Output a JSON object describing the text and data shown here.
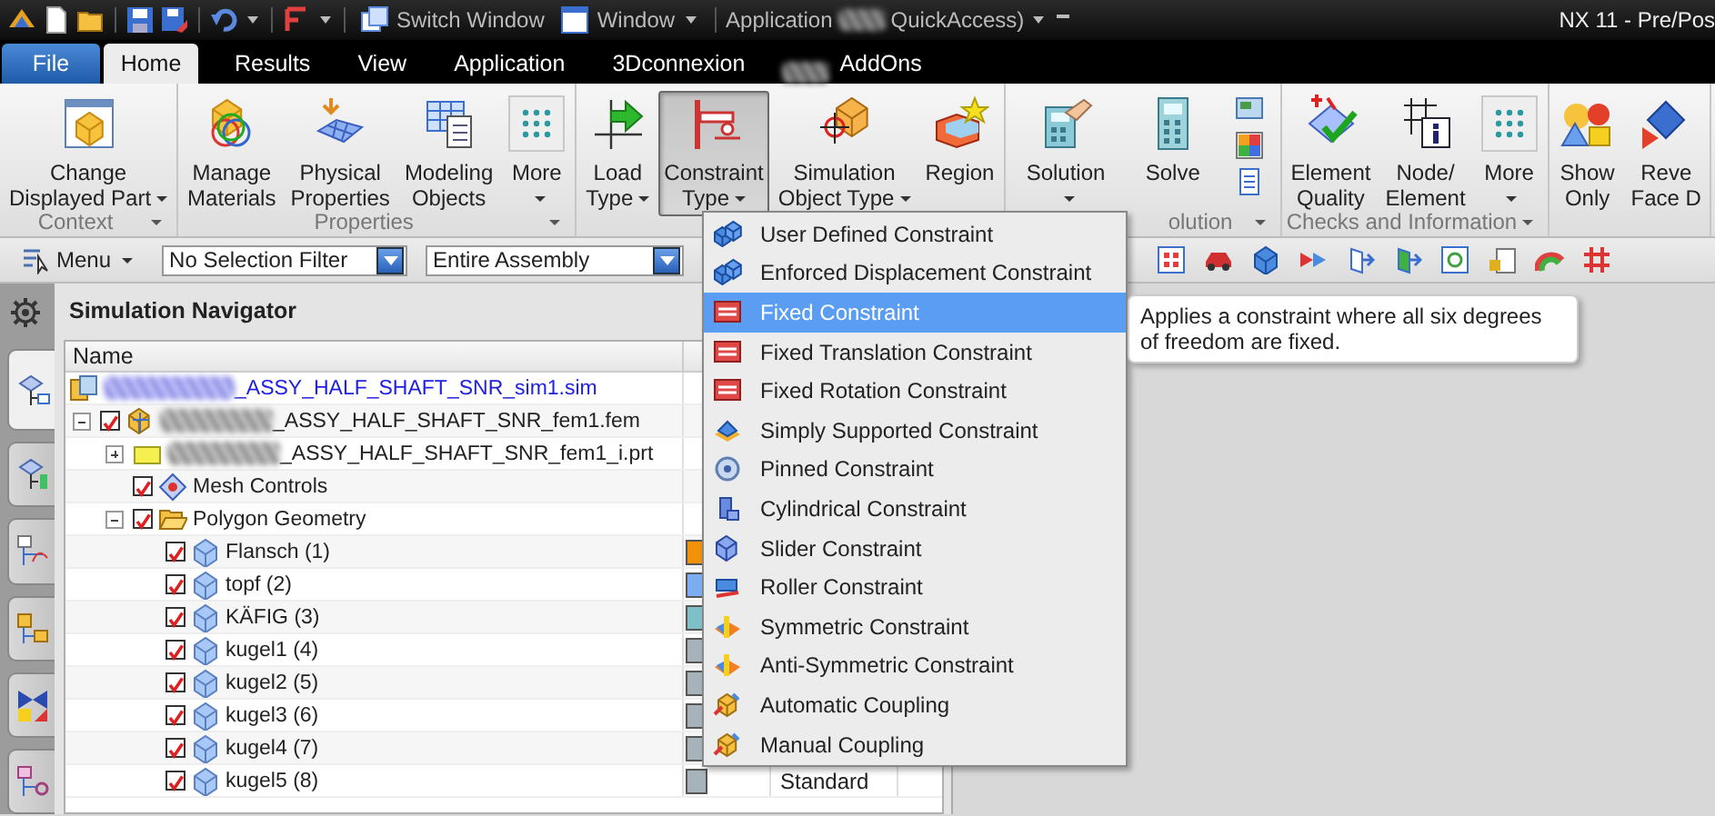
{
  "title_bar": {
    "switch_window": "Switch Window",
    "window_menu": "Window",
    "application": "Application",
    "quick_access": "QuickAccess)",
    "window_title": "NX 11 - Pre/Pos"
  },
  "tabs": [
    {
      "label": "File",
      "kind": "file",
      "selected": false
    },
    {
      "label": "Home",
      "kind": "tab",
      "selected": true
    },
    {
      "label": "Results",
      "kind": "tab",
      "selected": false
    },
    {
      "label": "View",
      "kind": "tab",
      "selected": false
    },
    {
      "label": "Application",
      "kind": "tab",
      "selected": false
    },
    {
      "label": "3Dconnexion",
      "kind": "tab",
      "selected": false
    },
    {
      "label": "AddOns",
      "kind": "tab",
      "selected": false,
      "redacted": true
    }
  ],
  "ribbon": [
    {
      "label": "Context",
      "launcher": true,
      "buttons": [
        {
          "lines": [
            "Change",
            "Displayed Part"
          ],
          "dropdown": true,
          "pressed": false
        }
      ]
    },
    {
      "label": "Properties",
      "launcher": true,
      "buttons": [
        {
          "lines": [
            "Manage",
            "Materials"
          ],
          "dropdown": false,
          "pressed": false
        },
        {
          "lines": [
            "Physical",
            "Properties"
          ],
          "dropdown": false,
          "pressed": false
        },
        {
          "lines": [
            "Modeling",
            "Objects"
          ],
          "dropdown": false,
          "pressed": false
        },
        {
          "lines": [
            "More"
          ],
          "dropdown": true,
          "pressed": false
        }
      ]
    },
    {
      "buttons": [
        {
          "lines": [
            "Load",
            "Type"
          ],
          "dropdown": true,
          "pressed": false
        },
        {
          "lines": [
            "Constraint",
            "Type"
          ],
          "dropdown": true,
          "pressed": true
        },
        {
          "lines": [
            "Simulation",
            "Object Type"
          ],
          "dropdown": true,
          "pressed": false
        },
        {
          "lines": [
            "Region"
          ],
          "dropdown": false,
          "pressed": false
        }
      ]
    },
    {
      "label": "olution",
      "launcher": true,
      "buttons": [
        {
          "lines": [
            "Solution"
          ],
          "dropdown": true,
          "pressed": false
        },
        {
          "lines": [
            "Solve"
          ],
          "dropdown": false,
          "pressed": false
        },
        {
          "kind": "stack"
        }
      ]
    },
    {
      "label": "Checks and Information",
      "launcher": true,
      "buttons": [
        {
          "lines": [
            "Element",
            "Quality"
          ],
          "dropdown": false,
          "pressed": false
        },
        {
          "lines": [
            "Node/",
            "Element"
          ],
          "dropdown": false,
          "pressed": false
        },
        {
          "lines": [
            "More"
          ],
          "dropdown": true,
          "pressed": false
        }
      ]
    },
    {
      "buttons": [
        {
          "lines": [
            "Show",
            "Only"
          ],
          "dropdown": false,
          "pressed": false
        },
        {
          "lines": [
            "Reve",
            "Face D"
          ],
          "dropdown": false,
          "pressed": false
        }
      ]
    }
  ],
  "toolbar": {
    "menu": "Menu",
    "filters": [
      "No Selection Filter",
      "Entire Assembly"
    ]
  },
  "side_tabs": [
    {
      "selected": true
    },
    {
      "selected": false
    },
    {
      "selected": false
    },
    {
      "selected": false
    },
    {
      "selected": false
    },
    {
      "selected": false
    }
  ],
  "navigator": {
    "title": "Simulation Navigator",
    "columns": [
      "Name"
    ],
    "tree": [
      {
        "name": "_ASSY_HALF_SHAFT_SNR_sim1.sim",
        "kind": "sim",
        "redacted": true
      },
      {
        "name": "_ASSY_HALF_SHAFT_SNR_fem1.fem",
        "kind": "fem",
        "redacted": true,
        "expanded": true,
        "checked": true,
        "children": [
          {
            "name": "_ASSY_HALF_SHAFT_SNR_fem1_i.prt",
            "kind": "part",
            "redacted": true,
            "expanded": false
          },
          {
            "name": "Mesh Controls",
            "kind": "mesh",
            "checked": true
          },
          {
            "name": "Polygon Geometry",
            "kind": "folder",
            "expanded": true,
            "checked": true,
            "children": [
              {
                "name": "Flansch (1)",
                "kind": "body",
                "checked": true,
                "color": "#f0920a"
              },
              {
                "name": "topf (2)",
                "kind": "body",
                "checked": true,
                "color": "#7aaef0"
              },
              {
                "name": "KÄFIG (3)",
                "kind": "body",
                "checked": true,
                "color": "#7fbfc8"
              },
              {
                "name": "kugel1 (4)",
                "kind": "body",
                "checked": true,
                "color": "#a6b3b8"
              },
              {
                "name": "kugel2 (5)",
                "kind": "body",
                "checked": true,
                "color": "#a6b3b8"
              },
              {
                "name": "kugel3 (6)",
                "kind": "body",
                "checked": true,
                "color": "#a6b3b8"
              },
              {
                "name": "kugel4 (7)",
                "kind": "body",
                "checked": true,
                "color": "#a6b3b8"
              },
              {
                "name": "kugel5 (8)",
                "kind": "body",
                "checked": true,
                "color": "#a6b3b8",
                "column_3": "Standard"
              }
            ]
          }
        ]
      }
    ]
  },
  "constraint_menu": {
    "items": [
      {
        "label": "User Defined Constraint",
        "selected": false
      },
      {
        "label": "Enforced Displacement Constraint",
        "selected": false
      },
      {
        "label": "Fixed Constraint",
        "selected": true
      },
      {
        "label": "Fixed Translation Constraint",
        "selected": false
      },
      {
        "label": "Fixed Rotation Constraint",
        "selected": false
      },
      {
        "label": "Simply Supported Constraint",
        "selected": false
      },
      {
        "label": "Pinned Constraint",
        "selected": false
      },
      {
        "label": "Cylindrical Constraint",
        "selected": false
      },
      {
        "label": "Slider Constraint",
        "selected": false
      },
      {
        "label": "Roller Constraint",
        "selected": false
      },
      {
        "label": "Symmetric Constraint",
        "selected": false
      },
      {
        "label": "Anti-Symmetric Constraint",
        "selected": false
      },
      {
        "label": "Automatic Coupling",
        "selected": false
      },
      {
        "label": "Manual Coupling",
        "selected": false
      }
    ],
    "tooltip": "Applies a constraint where all six degrees of freedom are fixed."
  }
}
